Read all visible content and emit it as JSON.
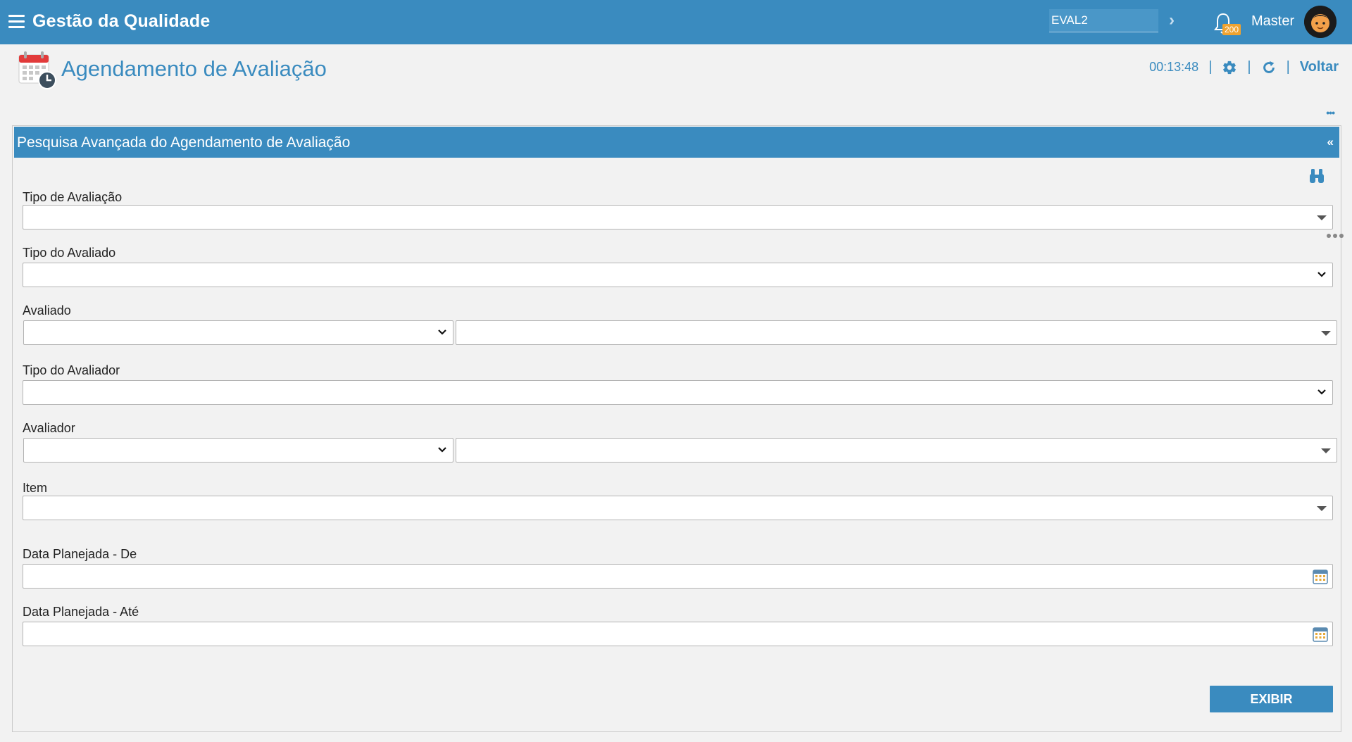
{
  "topbar": {
    "app_title": "Gestão da Qualidade",
    "env_value": "EVAL2",
    "notification_count": "200",
    "user_name": "Master"
  },
  "header": {
    "title": "Agendamento de Avaliação",
    "timer": "00:13:48",
    "back_label": "Voltar"
  },
  "panel": {
    "title": "Pesquisa Avançada do Agendamento de Avaliação",
    "collapse_glyph": "«",
    "fields": {
      "tipo_avaliacao": {
        "label": "Tipo de Avaliação",
        "value": ""
      },
      "tipo_avaliado": {
        "label": "Tipo do Avaliado",
        "value": ""
      },
      "avaliado": {
        "label": "Avaliado",
        "value": ""
      },
      "tipo_avaliador": {
        "label": "Tipo do Avaliador",
        "value": ""
      },
      "avaliador": {
        "label": "Avaliador",
        "value": ""
      },
      "item": {
        "label": "Item",
        "value": ""
      },
      "data_de": {
        "label": "Data Planejada - De",
        "value": ""
      },
      "data_ate": {
        "label": "Data Planejada - Até",
        "value": ""
      }
    },
    "submit_label": "EXIBIR"
  },
  "colors": {
    "primary": "#3a8bbf",
    "background": "#f2f2f2",
    "badge": "#f0a32f"
  },
  "icons": [
    "menu-icon",
    "chevron-right-icon",
    "bell-icon",
    "avatar",
    "calendar-clock-icon",
    "gear-icon",
    "refresh-icon",
    "more-icon",
    "binoculars-icon",
    "dropdown-icon",
    "calendar-icon"
  ]
}
